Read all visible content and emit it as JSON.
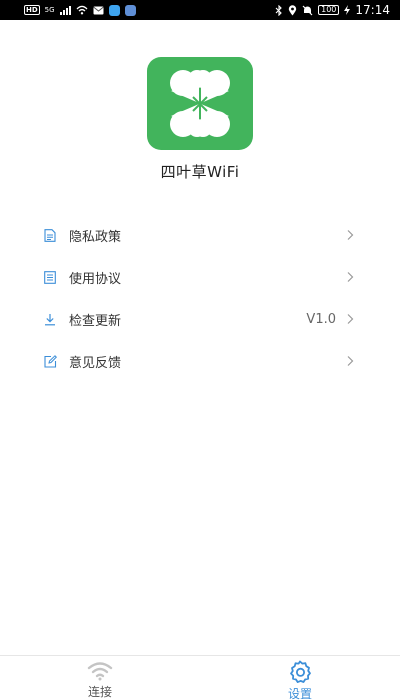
{
  "status_bar": {
    "left_badges": [
      "HD",
      "5G"
    ],
    "battery": "100",
    "time": "17:14"
  },
  "app": {
    "name": "四叶草WiFi",
    "brand_color": "#42b45c",
    "accent_color": "#3b8ed8"
  },
  "menu": {
    "items": [
      {
        "label": "隐私政策",
        "icon": "document-icon",
        "value": ""
      },
      {
        "label": "使用协议",
        "icon": "agreement-icon",
        "value": ""
      },
      {
        "label": "检查更新",
        "icon": "download-icon",
        "value": "V1.0"
      },
      {
        "label": "意见反馈",
        "icon": "edit-icon",
        "value": ""
      }
    ]
  },
  "bottom_nav": {
    "tabs": [
      {
        "label": "连接",
        "icon": "wifi-icon",
        "active": false
      },
      {
        "label": "设置",
        "icon": "gear-icon",
        "active": true
      }
    ]
  }
}
